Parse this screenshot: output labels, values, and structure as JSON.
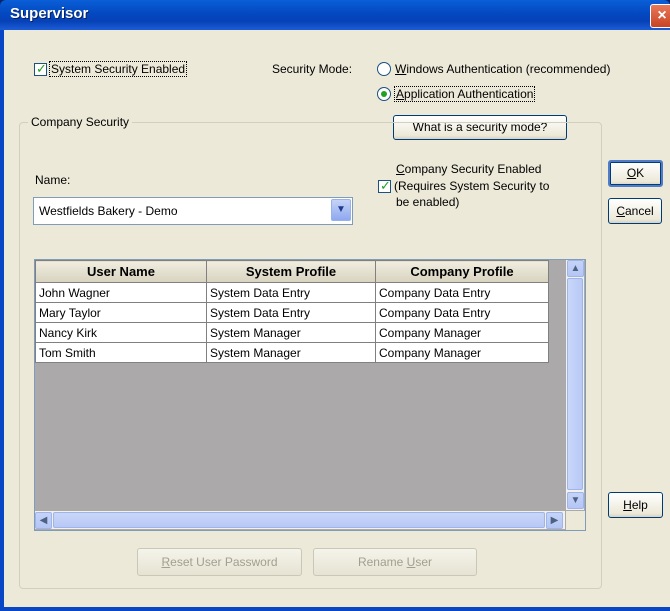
{
  "window": {
    "title": "Supervisor",
    "close_glyph": "×"
  },
  "system_security": {
    "label": "System Security Enabled",
    "checked": true
  },
  "security_mode": {
    "label": "Security Mode:",
    "options": [
      {
        "pre": "",
        "accel": "W",
        "post": "indows Authentication (recommended)",
        "selected": false
      },
      {
        "pre": "",
        "accel": "A",
        "post": "pplication Authentication",
        "selected": true
      }
    ],
    "help_button": "What is a security mode?"
  },
  "company_security": {
    "group_title": "Company Security",
    "name_label": "Name:",
    "name_value": "Westfields Bakery - Demo",
    "enabled_line1_accel": "C",
    "enabled_line1_rest": "ompany Security Enabled",
    "enabled_line2": "(Requires System Security to",
    "enabled_line3": "be enabled)",
    "enabled_checked": true
  },
  "buttons": {
    "ok_accel": "O",
    "ok_rest": "K",
    "cancel_accel": "C",
    "cancel_rest": "ancel",
    "help_accel": "H",
    "help_rest": "elp",
    "reset_accel": "R",
    "reset_rest": "eset User Password",
    "rename_pre": "Rename ",
    "rename_accel": "U",
    "rename_post": "ser"
  },
  "table": {
    "columns": [
      "User Name",
      "System Profile",
      "Company Profile"
    ],
    "rows": [
      [
        "John Wagner",
        "System Data Entry",
        "Company Data Entry"
      ],
      [
        "Mary Taylor",
        "System Data Entry",
        "Company Data Entry"
      ],
      [
        "Nancy Kirk",
        "System Manager",
        "Company Manager"
      ],
      [
        "Tom Smith",
        "System Manager",
        "Company Manager"
      ]
    ]
  },
  "icons": {
    "check": "✓",
    "up": "▲",
    "down": "▼",
    "left": "◀",
    "right": "▶",
    "combo_arrow": "▼"
  },
  "colors": {
    "title_bar": "#0348c0",
    "check_green": "#21a121",
    "dialog_bg": "#ece9d8"
  }
}
